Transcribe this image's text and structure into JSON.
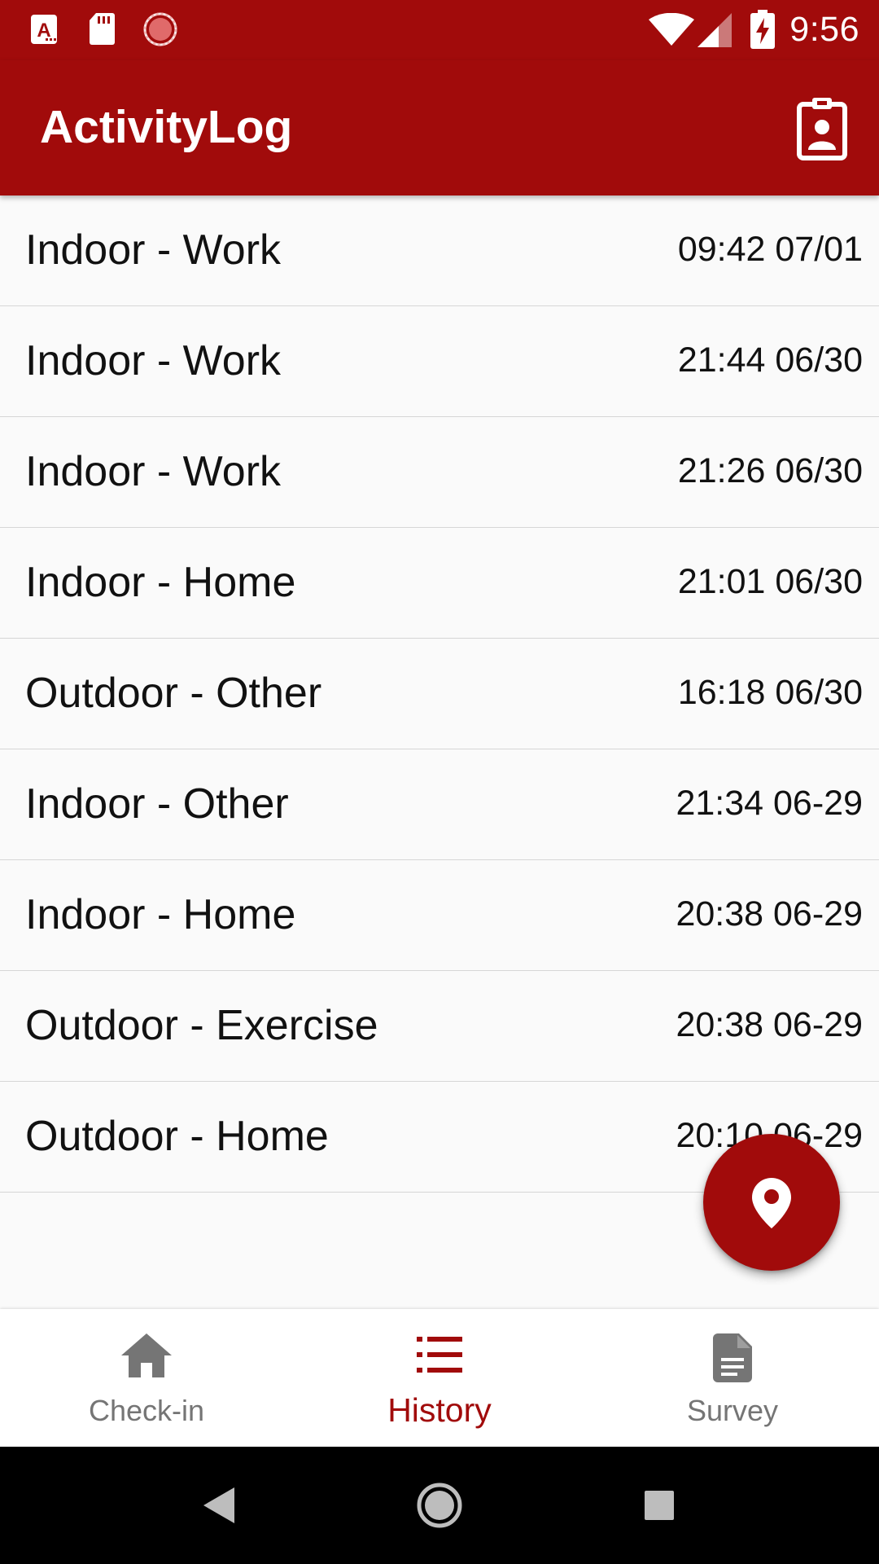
{
  "status_bar": {
    "time": "9:56",
    "left_icons": [
      "font-a-icon",
      "sd-card-icon",
      "sync-circle-icon"
    ],
    "right_icons": [
      "wifi-icon",
      "signal-icon",
      "battery-charging-icon"
    ]
  },
  "app_bar": {
    "title": "ActivityLog",
    "action_icon": "contact-badge-icon"
  },
  "history": {
    "entries": [
      {
        "label": "Indoor - Work",
        "time": "09:42 07/01"
      },
      {
        "label": "Indoor - Work",
        "time": "21:44 06/30"
      },
      {
        "label": "Indoor - Work",
        "time": "21:26 06/30"
      },
      {
        "label": "Indoor - Home",
        "time": "21:01 06/30"
      },
      {
        "label": "Outdoor - Other",
        "time": "16:18 06/30"
      },
      {
        "label": "Indoor - Other",
        "time": "21:34 06-29"
      },
      {
        "label": "Indoor - Home",
        "time": "20:38 06-29"
      },
      {
        "label": "Outdoor - Exercise",
        "time": "20:38 06-29"
      },
      {
        "label": "Outdoor - Home",
        "time": "20:10 06-29"
      }
    ]
  },
  "fab": {
    "icon": "location-pin-icon"
  },
  "bottom_nav": {
    "items": [
      {
        "label": "Check-in",
        "icon": "home-icon",
        "active": false
      },
      {
        "label": "History",
        "icon": "list-icon",
        "active": true
      },
      {
        "label": "Survey",
        "icon": "document-icon",
        "active": false
      }
    ]
  },
  "colors": {
    "primary": "#a10b0b",
    "inactive": "#757575",
    "background": "#fafafa"
  }
}
